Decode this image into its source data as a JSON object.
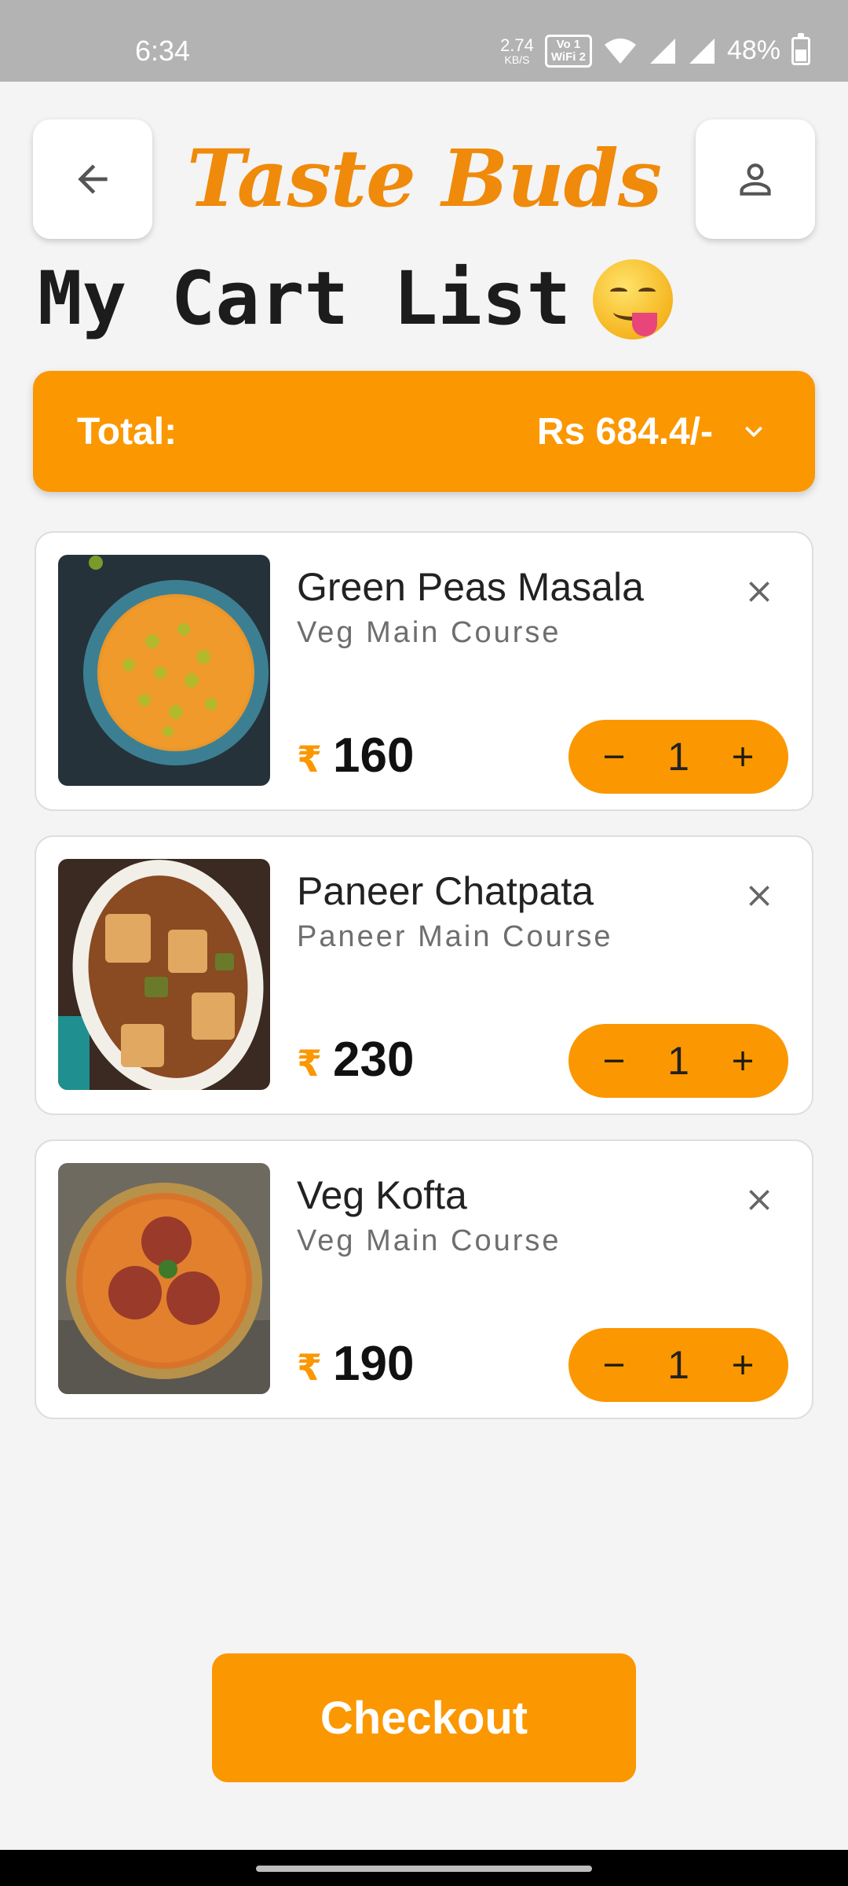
{
  "status_bar": {
    "time": "6:34",
    "net_speed_value": "2.74",
    "net_speed_unit": "KB/S",
    "volte_badge_top": "Vo 1",
    "volte_badge_bottom": "WiFi 2",
    "battery": "48%",
    "battery_level": 0.48
  },
  "header": {
    "app_name": "Taste Buds",
    "back_icon": "arrow-left-icon",
    "profile_icon": "person-icon"
  },
  "page": {
    "title": "My Cart List",
    "title_emoji": "face-savoring-food-emoji"
  },
  "total": {
    "label": "Total:",
    "amount": "Rs 684.4/-"
  },
  "currency_symbol": "₹",
  "cart_items": [
    {
      "name": "Green Peas Masala",
      "category": "Veg Main Course",
      "price": "160",
      "quantity": "1"
    },
    {
      "name": "Paneer Chatpata",
      "category": "Paneer Main Course",
      "price": "230",
      "quantity": "1"
    },
    {
      "name": "Veg Kofta",
      "category": "Veg Main Course",
      "price": "190",
      "quantity": "1"
    }
  ],
  "checkout_label": "Checkout",
  "colors": {
    "accent": "#fb9700",
    "logo": "#f08a0a",
    "background": "#f4f4f4"
  }
}
